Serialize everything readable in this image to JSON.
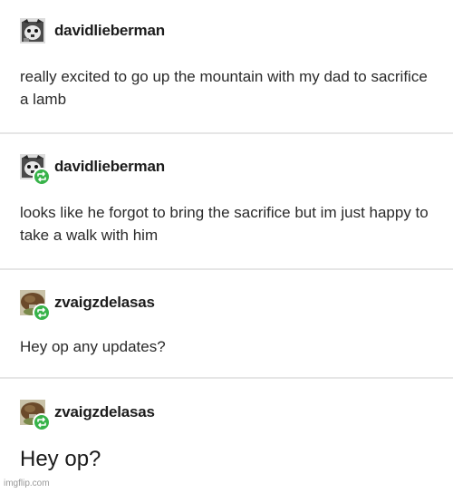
{
  "posts": [
    {
      "username": "davidlieberman",
      "text": "really excited to go up the mountain with my dad to sacrifice a lamb",
      "reblog": false
    },
    {
      "username": "davidlieberman",
      "text": "looks like he forgot to bring the sacrifice but im just happy to take a walk with him",
      "reblog": true
    },
    {
      "username": "zvaigzdelasas",
      "text": "Hey op any updates?",
      "reblog": true
    },
    {
      "username": "zvaigzdelasas",
      "text": "Hey op?",
      "reblog": true
    }
  ],
  "watermark": "imgflip.com",
  "colors": {
    "reblog_badge": "#38b34a",
    "divider": "#e6e6e6",
    "text": "#222222"
  },
  "icons": {
    "avatar_1": "bw-cat-avatar-icon",
    "avatar_2": "mushroom-avatar-icon",
    "reblog_badge": "reblog-icon"
  }
}
